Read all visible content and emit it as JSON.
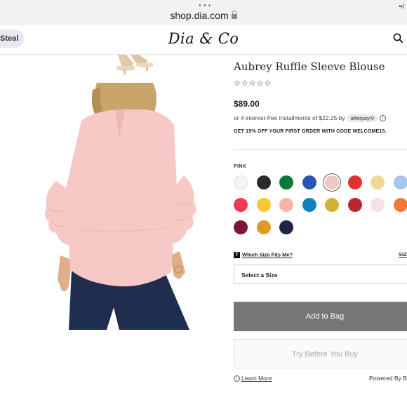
{
  "browser": {
    "dots": "•••",
    "url": "shop.dia.com",
    "status": "•ıl"
  },
  "header": {
    "steal_label": "Steal",
    "logo": "Dia & Co"
  },
  "product": {
    "title": "Aubrey Ruffle Sleeve Blouse",
    "stars": "☆☆☆☆☆",
    "price": "$89.00",
    "installments_text": "or 4 interest-free installments of $22.25 by",
    "afterpay_label": "afterpay⟲",
    "info_glyph": "i",
    "promo": "GET 15% OFF YOUR FIRST ORDER WITH CODE WELCOME15.",
    "color_label": "PINK",
    "swatches": [
      {
        "color": "#f4f4f1"
      },
      {
        "color": "#2b2b2b"
      },
      {
        "color": "#0a7a3c"
      },
      {
        "color": "#2a55b5"
      },
      {
        "color": "#efc6c0",
        "selected": true
      },
      {
        "color": "#e2322e"
      },
      {
        "color": "#efd99a"
      },
      {
        "color": "#a6c4ee"
      },
      {
        "color": "#ee3a55"
      },
      {
        "color": "#f7c932"
      },
      {
        "color": "#f6b3a6"
      },
      {
        "color": "#1283b8"
      },
      {
        "color": "#d3b337"
      },
      {
        "color": "#b8262e"
      },
      {
        "color": "#f6e0e8"
      },
      {
        "color": "#f07a33"
      },
      {
        "color": "#7b1731"
      },
      {
        "color": "#dd9a26"
      },
      {
        "color": "#1d2446"
      }
    ],
    "size_help_icon": "T",
    "size_help": "Which Size Fits Me?",
    "size_chart": "SIZ",
    "size_select": "Select a Size",
    "add_to_bag": "Add to Bag",
    "try_before": "Try Before You Buy",
    "learn_more": "Learn More",
    "powered_by": "Powered By Bl"
  },
  "colors": {
    "blouse": "#f6c8c6",
    "jeans": "#1f2d4f",
    "add_button": "#767676"
  }
}
